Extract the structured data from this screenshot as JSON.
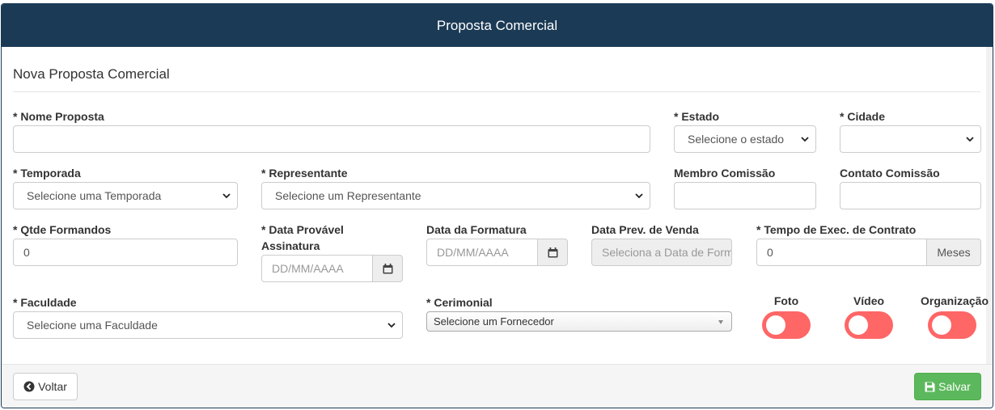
{
  "header": {
    "title": "Proposta Comercial"
  },
  "section": {
    "title": "Nova Proposta Comercial"
  },
  "fields": {
    "nome_proposta": {
      "label": "* Nome Proposta",
      "value": ""
    },
    "estado": {
      "label": "* Estado",
      "selected": "Selecione o estado"
    },
    "cidade": {
      "label": "* Cidade",
      "selected": ""
    },
    "temporada": {
      "label": "* Temporada",
      "selected": "Selecione uma Temporada"
    },
    "representante": {
      "label": "* Representante",
      "selected": "Selecione um Representante"
    },
    "membro_comissao": {
      "label": "Membro Comissão",
      "value": ""
    },
    "contato_comissao": {
      "label": "Contato Comissão",
      "value": ""
    },
    "qtde_formandos": {
      "label": "* Qtde Formandos",
      "value": "0"
    },
    "data_assinatura": {
      "label_line1": "* Data Provável",
      "label_line2": "Assinatura",
      "placeholder": "DD/MM/AAAA"
    },
    "data_formatura": {
      "label": "Data da Formatura",
      "placeholder": "DD/MM/AAAA"
    },
    "data_prev_venda": {
      "label": "Data Prev. de Venda",
      "value": "Seleciona a Data de Formatura"
    },
    "tempo_exec": {
      "label": "* Tempo de Exec. de Contrato",
      "value": "0",
      "addon": "Meses"
    },
    "faculdade": {
      "label": "* Faculdade",
      "selected": "Selecione uma Faculdade"
    },
    "cerimonial": {
      "label": "* Cerimonial",
      "selected": "Selecione um Fornecedor"
    }
  },
  "toggles": [
    {
      "label": "Foto",
      "state": "off"
    },
    {
      "label": "Vídeo",
      "state": "off"
    },
    {
      "label": "Organização",
      "state": "off"
    }
  ],
  "footer": {
    "back_label": "Voltar",
    "save_label": "Salvar"
  },
  "colors": {
    "header_bg": "#1b3a55",
    "toggle_off": "#ff6666",
    "save_btn": "#5cb85c"
  },
  "icons": {
    "calendar": "calendar-icon",
    "back": "arrow-circle-left-icon",
    "save": "floppy-disk-icon",
    "caret": "chevron-down-icon"
  }
}
